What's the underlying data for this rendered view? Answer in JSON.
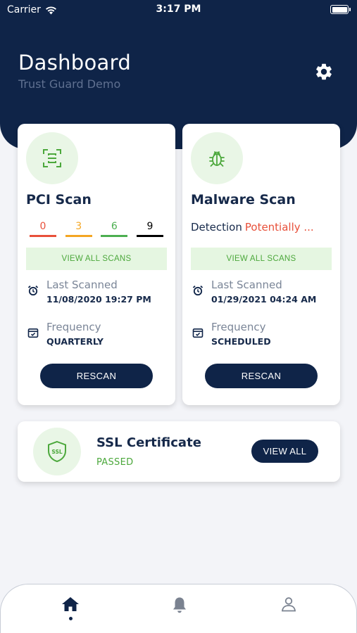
{
  "status_bar": {
    "carrier": "Carrier",
    "time": "3:17 PM",
    "wifi_icon": "wifi-icon",
    "battery_icon": "battery-icon"
  },
  "header": {
    "title": "Dashboard",
    "subtitle": "Trust Guard Demo",
    "settings_icon": "gear-icon"
  },
  "colors": {
    "primary": "#0f2448",
    "accent_green": "#4ca83c",
    "light_green": "#e5f6e1",
    "danger": "#e8503a",
    "warning": "#f4a623",
    "count_green": "#4caf50",
    "neutral": "#000000"
  },
  "pci_card": {
    "icon": "scan-frame-icon",
    "title": "PCI Scan",
    "counts": [
      {
        "value": "0",
        "color": "#e8503a"
      },
      {
        "value": "3",
        "color": "#f4a623"
      },
      {
        "value": "6",
        "color": "#4caf50"
      },
      {
        "value": "9",
        "color": "#000000"
      }
    ],
    "view_all_label": "VIEW ALL SCANS",
    "last_scanned_label": "Last Scanned",
    "last_scanned_value": "11/08/2020 19:27 PM",
    "frequency_label": "Frequency",
    "frequency_value": "QUARTERLY",
    "rescan_label": "RESCAN"
  },
  "malware_card": {
    "icon": "bug-icon",
    "title": "Malware Scan",
    "detection_label": "Detection",
    "detection_value": "Potentially ...",
    "view_all_label": "VIEW ALL SCANS",
    "last_scanned_label": "Last Scanned",
    "last_scanned_value": "01/29/2021 04:24 AM",
    "frequency_label": "Frequency",
    "frequency_value": "SCHEDULED",
    "rescan_label": "RESCAN"
  },
  "ssl_card": {
    "icon": "ssl-shield-icon",
    "icon_text": "SSL",
    "title": "SSL Certificate",
    "status": "PASSED",
    "view_all_label": "VIEW ALL"
  },
  "tab_bar": {
    "tabs": [
      {
        "icon": "home-icon",
        "active": true
      },
      {
        "icon": "bell-icon",
        "active": false
      },
      {
        "icon": "user-icon",
        "active": false
      }
    ]
  }
}
